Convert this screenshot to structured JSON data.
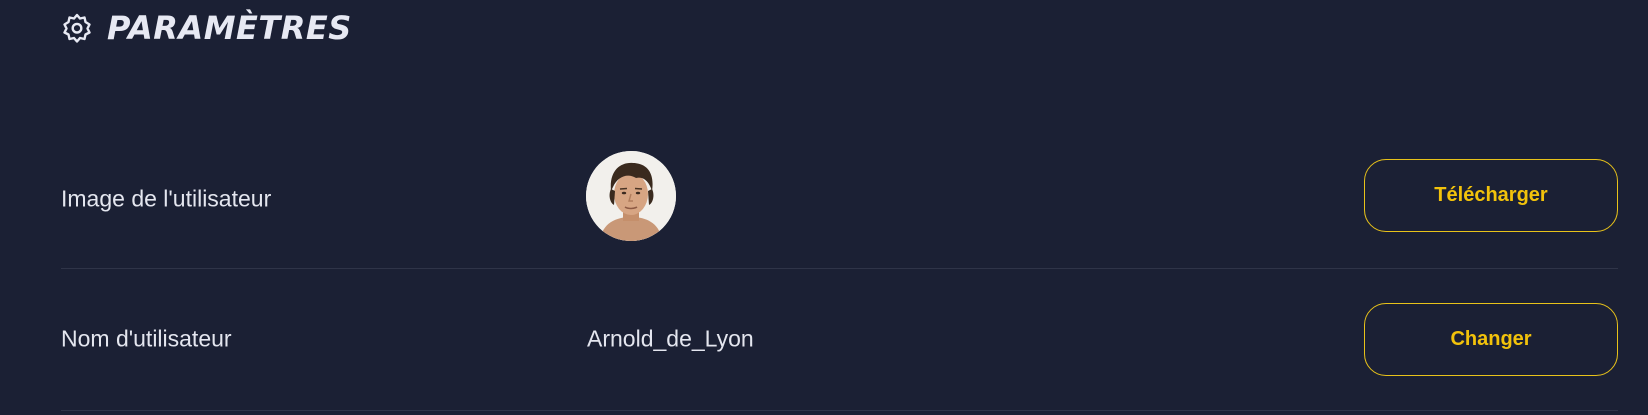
{
  "header": {
    "icon": "gear-icon",
    "title": "PARAMÈTRES"
  },
  "settings": [
    {
      "label": "Image de l'utilisateur",
      "value_type": "avatar",
      "action_label": "Télécharger"
    },
    {
      "label": "Nom d'utilisateur",
      "value": "Arnold_de_Lyon",
      "action_label": "Changer"
    }
  ],
  "colors": {
    "background": "#1b2034",
    "accent": "#f2c20b",
    "text": "#e4e6ef",
    "divider": "#2f3448"
  }
}
